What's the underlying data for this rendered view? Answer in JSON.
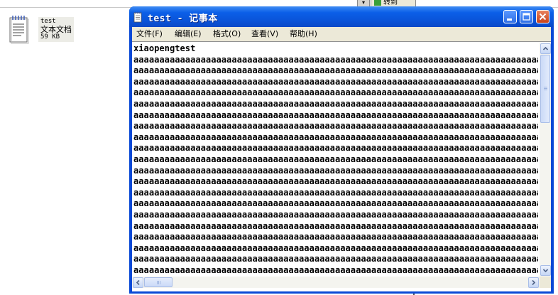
{
  "explorer": {
    "goto_label": "转到",
    "dropdown_arrow": "▾"
  },
  "desktop_file": {
    "name": "test",
    "type": "文本文档",
    "size": "59 KB",
    "icon": "notepad-document-icon"
  },
  "window": {
    "title": "test - 记事本",
    "icon": "notepad-icon",
    "controls": {
      "minimize": "minimize-icon",
      "maximize": "maximize-icon",
      "close": "close-icon"
    },
    "menu": [
      {
        "label": "文件(F)"
      },
      {
        "label": "编辑(E)"
      },
      {
        "label": "格式(O)"
      },
      {
        "label": "查看(V)"
      },
      {
        "label": "帮助(H)"
      }
    ],
    "content": {
      "first_line": "xiaopengtest",
      "repeated_line": "aaaaaaaaaaaaaaaaaaaaaaaaaaaaaaaaaaaaaaaaaaaaaaaaaaaaaaaaaaaaaaaaaaaaaaaaaaaaaaaaaaaaa"
    }
  },
  "colors": {
    "title_bar": "#0a53d8",
    "menu_background": "#ece9d8",
    "close_button": "#c9421a"
  }
}
